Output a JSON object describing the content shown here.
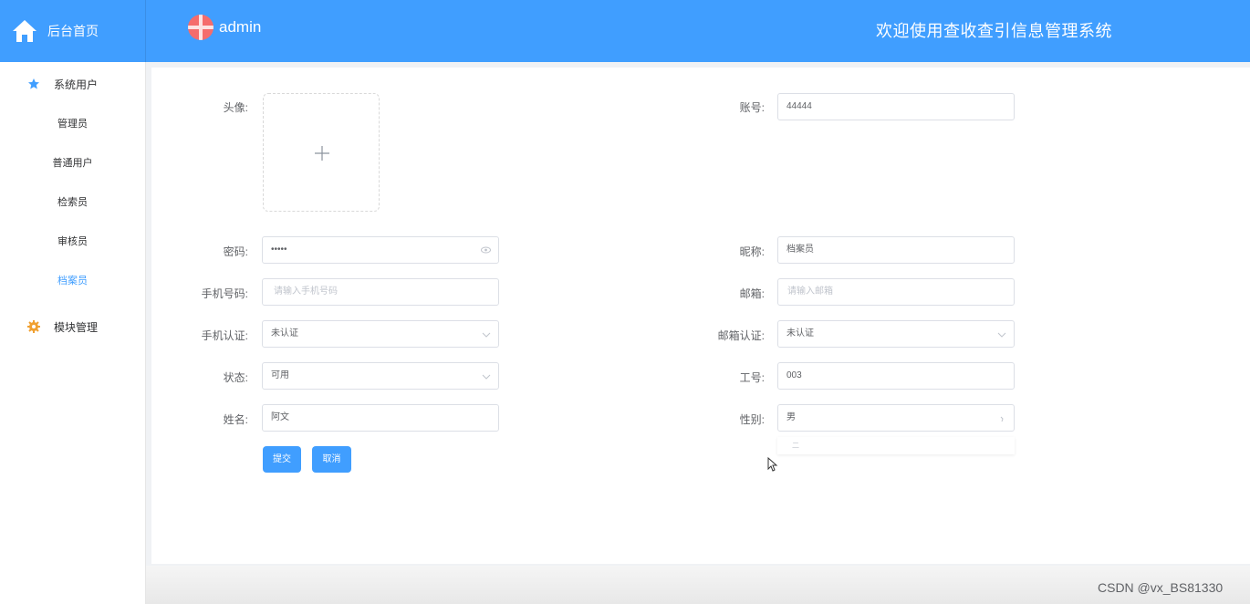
{
  "header": {
    "home_label": "后台首页",
    "username": "admin",
    "site_title": "欢迎使用查收查引信息管理系统"
  },
  "sidebar": {
    "group1": "系统用户",
    "items": [
      "管理员",
      "普通用户",
      "检索员",
      "审核员",
      "档案员"
    ],
    "active_item": "档案员",
    "group2": "模块管理"
  },
  "form": {
    "avatar_label": "头像:",
    "account_label": "账号:",
    "account_value": "44444",
    "password_label": "密码:",
    "password_value": "•••••",
    "nickname_label": "昵称:",
    "nickname_value": "档案员",
    "phone_label": "手机号码:",
    "phone_placeholder": "请输入手机号码",
    "email_label": "邮箱:",
    "email_placeholder": "请输入邮箱",
    "phone_verify_label": "手机认证:",
    "phone_verify_value": "未认证",
    "email_verify_label": "邮箱认证:",
    "email_verify_value": "未认证",
    "status_label": "状态:",
    "status_value": "可用",
    "job_no_label": "工号:",
    "job_no_value": "003",
    "name_label": "姓名:",
    "name_value": "阿文",
    "gender_label": "性别:",
    "gender_value": "男",
    "gender_dropdown_hint": "二",
    "submit_label": "提交",
    "cancel_label": "取消"
  },
  "watermark": "CSDN @vx_BS81330",
  "colors": {
    "primary": "#409eff",
    "active": "#409eff",
    "module_icon": "#f0a030"
  }
}
